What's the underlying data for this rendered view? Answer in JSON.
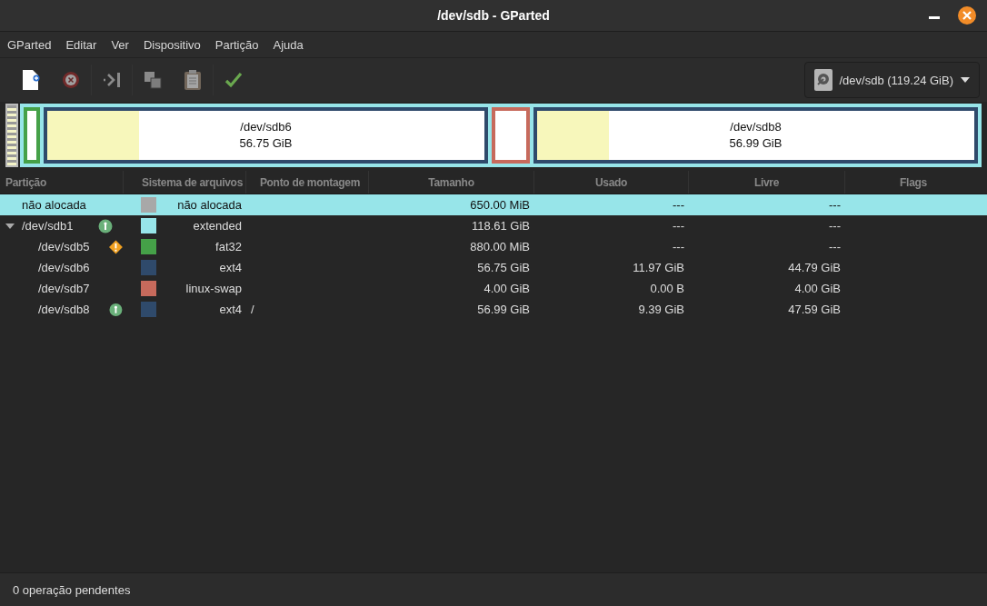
{
  "window": {
    "title": "/dev/sdb - GParted"
  },
  "menu": [
    "GParted",
    "Editar",
    "Ver",
    "Dispositivo",
    "Partição",
    "Ajuda"
  ],
  "toolbar": [
    {
      "kind": "new",
      "disabled": false
    },
    {
      "kind": "delete",
      "disabled": true
    },
    {
      "kind": "resize",
      "disabled": true
    },
    {
      "kind": "copy",
      "disabled": true
    },
    {
      "kind": "paste",
      "disabled": true
    },
    {
      "kind": "apply",
      "disabled": false
    }
  ],
  "device_selector": {
    "label": "/dev/sdb (119.24 GiB)"
  },
  "disk_map": {
    "unallocated": {
      "selected": true
    },
    "extended": {
      "partitions": [
        {
          "kind": "sliver",
          "color": "#45a148"
        },
        {
          "kind": "labeled",
          "color": "#2f4a6b",
          "level": 0.21,
          "name": "/dev/sdb6",
          "size": "56.75 GiB"
        },
        {
          "kind": "small",
          "color": "#c76a5c"
        },
        {
          "kind": "labeled",
          "color": "#2f4a6b",
          "level": 0.165,
          "name": "/dev/sdb8",
          "size": "56.99 GiB"
        }
      ]
    }
  },
  "table": {
    "columns": [
      "Partição",
      "Sistema de arquivos",
      "Ponto de montagem",
      "Tamanho",
      "Usado",
      "Livre",
      "Flags"
    ],
    "rows": [
      {
        "partition": "não alocada",
        "selected": true,
        "mounted": false,
        "warning": false,
        "color": "#a8a8a8",
        "filesystem": "não alocada",
        "size": "650.00 MiB",
        "used": "---",
        "free": "---"
      },
      {
        "partition": "/dev/sdb1",
        "selected": false,
        "expanded": true,
        "mounted": true,
        "warning": false,
        "color": "#97e5e9",
        "filesystem": "extended",
        "size": "118.61 GiB",
        "used": "---",
        "free": "---",
        "children": [
          {
            "partition": "/dev/sdb5",
            "selected": false,
            "mounted": false,
            "warning": true,
            "color": "#45a148",
            "filesystem": "fat32",
            "size": "880.00 MiB",
            "used": "---",
            "free": "---"
          },
          {
            "partition": "/dev/sdb6",
            "selected": false,
            "mounted": false,
            "warning": false,
            "color": "#2f4a6b",
            "filesystem": "ext4",
            "size": "56.75 GiB",
            "used": "11.97 GiB",
            "free": "44.79 GiB"
          },
          {
            "partition": "/dev/sdb7",
            "selected": false,
            "mounted": false,
            "warning": false,
            "color": "#c76a5c",
            "filesystem": "linux-swap",
            "size": "4.00 GiB",
            "used": "0.00 B",
            "free": "4.00 GiB"
          },
          {
            "partition": "/dev/sdb8",
            "selected": false,
            "mounted": true,
            "warning": false,
            "color": "#2f4a6b",
            "filesystem": "ext4",
            "mount": "/",
            "size": "56.99 GiB",
            "used": "9.39 GiB",
            "free": "47.59 GiB"
          }
        ]
      }
    ]
  },
  "status_bar": "0 operação pendentes"
}
